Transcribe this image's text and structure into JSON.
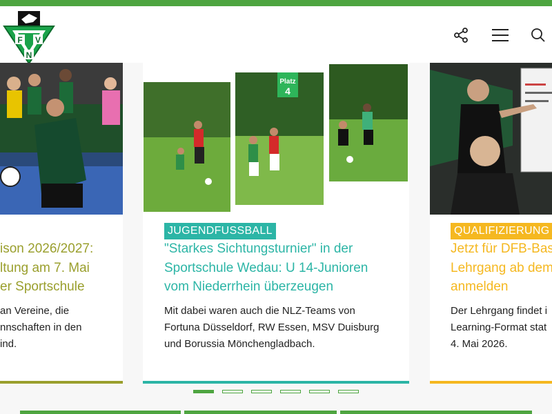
{
  "colors": {
    "accent": "#4ea540",
    "cyan": "#2cb5a6",
    "olive": "#9a9f2d",
    "amber": "#f5b820"
  },
  "header": {
    "logo": {
      "name": "FVN logo",
      "letters": [
        "F",
        "V",
        "N"
      ]
    },
    "icons": [
      "share-icon",
      "menu-icon",
      "search-icon"
    ]
  },
  "cards": [
    {
      "title": "ison 2026/2027:\nltung am 7. Mai\ner Sportschule",
      "excerpt": "an Vereine, die\nnnschaften in den\nind."
    },
    {
      "tag": "JUGENDFUSSBALL",
      "title": "\"Starkes Sichtungsturnier\" in der\nSportschule Wedau: U 14-Junioren\nvom Niederrhein überzeugen",
      "excerpt": "Mit dabei waren auch die NLZ-Teams von\nFortuna Düsseldorf, RW Essen, MSV Duisburg\nund Borussia Mönchengladbach.",
      "photo_sign": "Platz\n4"
    },
    {
      "tag": "QUALIFIZIERUNG",
      "title": "Jetzt für DFB-Bas\nLehrgang ab dem\nanmelden",
      "excerpt": "Der Lehrgang findet i\nLearning-Format stat\n4. Mai 2026."
    }
  ],
  "pagination": {
    "count": 6,
    "active": 0
  }
}
